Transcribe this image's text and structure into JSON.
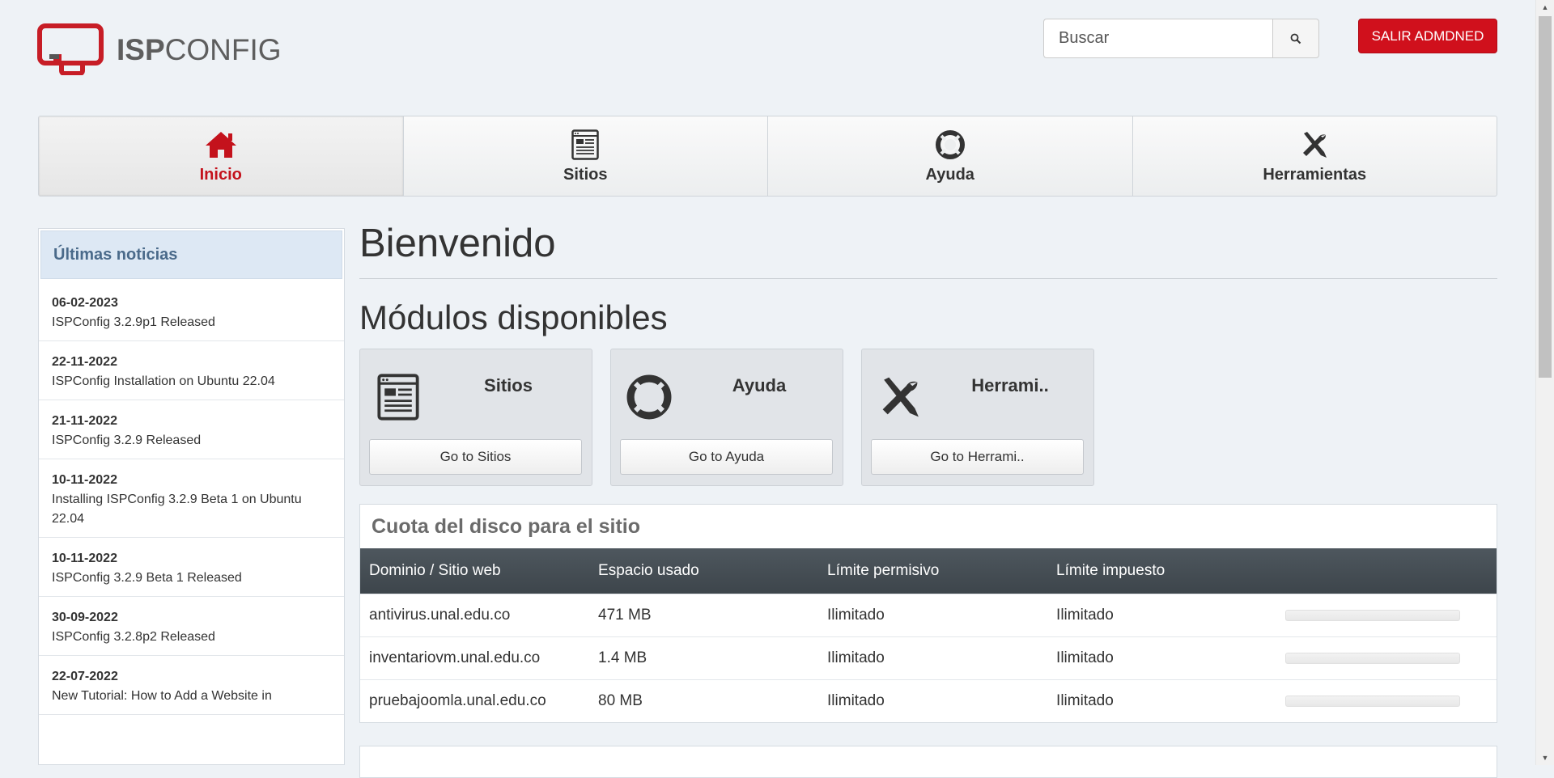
{
  "header": {
    "logo_text_bold": "ISP",
    "logo_text_light": "CONFIG",
    "search_placeholder": "Buscar",
    "logout_label": "SALIR ADMDNED"
  },
  "tabs": [
    {
      "label": "Inicio",
      "icon": "home-icon",
      "active": true
    },
    {
      "label": "Sitios",
      "icon": "sites-icon",
      "active": false
    },
    {
      "label": "Ayuda",
      "icon": "help-lifebuoy-icon",
      "active": false
    },
    {
      "label": "Herramientas",
      "icon": "tools-icon",
      "active": false
    }
  ],
  "sidebar": {
    "title": "Últimas noticias",
    "news": [
      {
        "date": "06-02-2023",
        "title": "ISPConfig 3.2.9p1 Released"
      },
      {
        "date": "22-11-2022",
        "title": "ISPConfig Installation on Ubuntu 22.04"
      },
      {
        "date": "21-11-2022",
        "title": "ISPConfig 3.2.9 Released"
      },
      {
        "date": "10-11-2022",
        "title": "Installing ISPConfig 3.2.9 Beta 1 on Ubuntu 22.04"
      },
      {
        "date": "10-11-2022",
        "title": "ISPConfig 3.2.9 Beta 1 Released"
      },
      {
        "date": "30-09-2022",
        "title": "ISPConfig 3.2.8p2 Released"
      },
      {
        "date": "22-07-2022",
        "title": "New Tutorial: How to Add a Website in"
      }
    ]
  },
  "main": {
    "welcome": "Bienvenido",
    "modules_title": "Módulos disponibles",
    "modules": [
      {
        "title": "Sitios",
        "button": "Go to Sitios",
        "icon": "sites-icon"
      },
      {
        "title": "Ayuda",
        "button": "Go to Ayuda",
        "icon": "help-lifebuoy-icon"
      },
      {
        "title": "Herrami..",
        "button": "Go to Herrami..",
        "icon": "tools-icon"
      }
    ],
    "quota": {
      "title": "Cuota del disco para el sitio",
      "columns": [
        "Dominio / Sitio web",
        "Espacio usado",
        "Límite permisivo",
        "Límite impuesto"
      ],
      "rows": [
        {
          "domain": "antivirus.unal.edu.co",
          "used": "471 MB",
          "soft": "Ilimitado",
          "hard": "Ilimitado",
          "usage_fraction": 0
        },
        {
          "domain": "inventariovm.unal.edu.co",
          "used": "1.4 MB",
          "soft": "Ilimitado",
          "hard": "Ilimitado",
          "usage_fraction": 0
        },
        {
          "domain": "pruebajoomla.unal.edu.co",
          "used": "80 MB",
          "soft": "Ilimitado",
          "hard": "Ilimitado",
          "usage_fraction": 0
        }
      ]
    }
  },
  "colors": {
    "accent_red": "#d0101c",
    "table_header": "#454d53",
    "page_bg": "#eef2f6"
  }
}
